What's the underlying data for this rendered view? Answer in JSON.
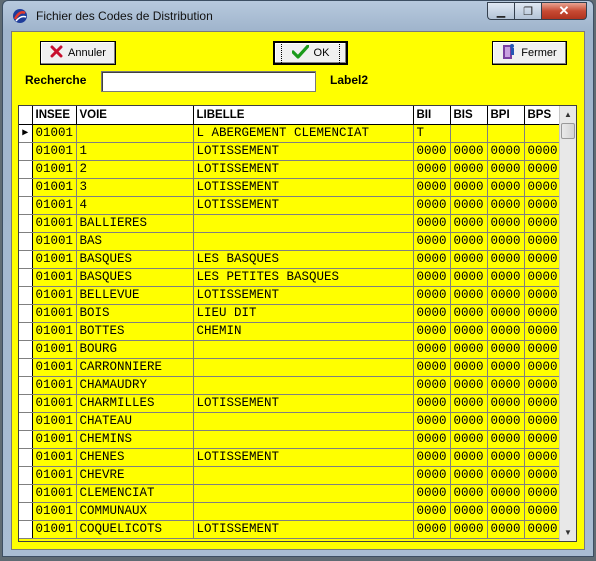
{
  "window": {
    "title": "Fichier des Codes de Distribution",
    "close_glyph": "✕",
    "min_glyph": "▁",
    "max_glyph": "❐"
  },
  "toolbar": {
    "annuler_label": "Annuler",
    "ok_label": "OK",
    "fermer_label": "Fermer",
    "annuler_icon": "red-x-icon",
    "ok_icon": "green-check-icon",
    "fermer_icon": "exit-door-icon"
  },
  "search": {
    "label": "Recherche",
    "value": "",
    "label2": "Label2"
  },
  "grid": {
    "columns": [
      "INSEE",
      "VOIE",
      "LIBELLE",
      "BII",
      "BIS",
      "BPI",
      "BPS"
    ],
    "current_row_marker": "▶",
    "rows": [
      [
        "01001",
        "",
        "L ABERGEMENT CLEMENCIAT",
        "T",
        "",
        "",
        ""
      ],
      [
        "01001",
        "1",
        "LOTISSEMENT",
        "0000",
        "0000",
        "0000",
        "0000"
      ],
      [
        "01001",
        "2",
        "LOTISSEMENT",
        "0000",
        "0000",
        "0000",
        "0000"
      ],
      [
        "01001",
        "3",
        "LOTISSEMENT",
        "0000",
        "0000",
        "0000",
        "0000"
      ],
      [
        "01001",
        "4",
        "LOTISSEMENT",
        "0000",
        "0000",
        "0000",
        "0000"
      ],
      [
        "01001",
        "BALLIERES",
        "",
        "0000",
        "0000",
        "0000",
        "0000"
      ],
      [
        "01001",
        "BAS",
        "",
        "0000",
        "0000",
        "0000",
        "0000"
      ],
      [
        "01001",
        "BASQUES",
        "LES BASQUES",
        "0000",
        "0000",
        "0000",
        "0000"
      ],
      [
        "01001",
        "BASQUES",
        "LES PETITES BASQUES",
        "0000",
        "0000",
        "0000",
        "0000"
      ],
      [
        "01001",
        "BELLEVUE",
        "LOTISSEMENT",
        "0000",
        "0000",
        "0000",
        "0000"
      ],
      [
        "01001",
        "BOIS",
        "LIEU DIT",
        "0000",
        "0000",
        "0000",
        "0000"
      ],
      [
        "01001",
        "BOTTES",
        "CHEMIN",
        "0000",
        "0000",
        "0000",
        "0000"
      ],
      [
        "01001",
        "BOURG",
        "",
        "0000",
        "0000",
        "0000",
        "0000"
      ],
      [
        "01001",
        "CARRONNIERE",
        "",
        "0000",
        "0000",
        "0000",
        "0000"
      ],
      [
        "01001",
        "CHAMAUDRY",
        "",
        "0000",
        "0000",
        "0000",
        "0000"
      ],
      [
        "01001",
        "CHARMILLES",
        "LOTISSEMENT",
        "0000",
        "0000",
        "0000",
        "0000"
      ],
      [
        "01001",
        "CHATEAU",
        "",
        "0000",
        "0000",
        "0000",
        "0000"
      ],
      [
        "01001",
        "CHEMINS",
        "",
        "0000",
        "0000",
        "0000",
        "0000"
      ],
      [
        "01001",
        "CHENES",
        "LOTISSEMENT",
        "0000",
        "0000",
        "0000",
        "0000"
      ],
      [
        "01001",
        "CHEVRE",
        "",
        "0000",
        "0000",
        "0000",
        "0000"
      ],
      [
        "01001",
        "CLEMENCIAT",
        "",
        "0000",
        "0000",
        "0000",
        "0000"
      ],
      [
        "01001",
        "COMMUNAUX",
        "",
        "0000",
        "0000",
        "0000",
        "0000"
      ],
      [
        "01001",
        "COQUELICOTS",
        "LOTISSEMENT",
        "0000",
        "0000",
        "0000",
        "0000"
      ]
    ]
  },
  "colors": {
    "client_bg": "#ffff00",
    "header_bg": "#ffffff"
  }
}
